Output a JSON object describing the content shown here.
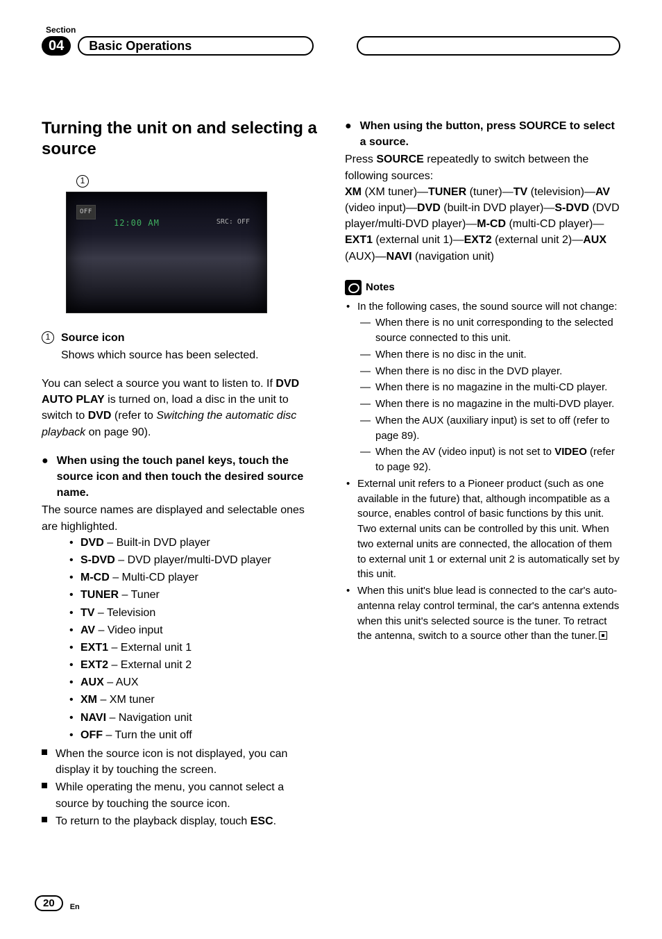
{
  "header": {
    "section_label": "Section",
    "section_number": "04",
    "chapter_title": "Basic Operations"
  },
  "left": {
    "main_heading": "Turning the unit on and selecting a source",
    "callout": "1",
    "screenshot": {
      "off_box": "OFF",
      "time": "12:00 AM",
      "src_off": "SRC: OFF"
    },
    "legend": {
      "num": "1",
      "title": "Source icon",
      "desc": "Shows which source has been selected."
    },
    "intro_1a": "You can select a source you want to listen to. If ",
    "intro_1b": "DVD AUTO PLAY",
    "intro_1c": " is turned on, load a disc in the unit to switch to ",
    "intro_1d": "DVD",
    "intro_1e": " (refer to ",
    "intro_1f": "Switching the automatic disc playback",
    "intro_1g": " on page 90).",
    "touch_head": "When using the touch panel keys, touch the source icon and then touch the desired source name.",
    "touch_body": "The source names are displayed and selectable ones are highlighted.",
    "sources": [
      {
        "key": "DVD",
        "desc": " – Built-in DVD player"
      },
      {
        "key": "S-DVD",
        "desc": " – DVD player/multi-DVD player"
      },
      {
        "key": "M-CD",
        "desc": " – Multi-CD player"
      },
      {
        "key": "TUNER",
        "desc": " – Tuner"
      },
      {
        "key": "TV",
        "desc": " – Television"
      },
      {
        "key": "AV",
        "desc": " – Video input"
      },
      {
        "key": "EXT1",
        "desc": " – External unit 1"
      },
      {
        "key": "EXT2",
        "desc": " – External unit 2"
      },
      {
        "key": "AUX",
        "desc": " – AUX"
      },
      {
        "key": "XM",
        "desc": " – XM tuner"
      },
      {
        "key": "NAVI",
        "desc": " – Navigation unit"
      },
      {
        "key": "OFF",
        "desc": " – Turn the unit off"
      }
    ],
    "note1": "When the source icon is not displayed, you can display it by touching the screen.",
    "note2": "While operating the menu, you cannot select a source by touching the source icon.",
    "note3a": "To return to the playback display, touch ",
    "note3b": "ESC",
    "note3c": "."
  },
  "right": {
    "button_head_a": "When using the button, press SOURCE to select a source.",
    "button_body_a": "Press ",
    "button_body_b": "SOURCE",
    "button_body_c": " repeatedly to switch between the following sources:",
    "chain": {
      "xm": "XM",
      "xm_d": " (XM tuner)—",
      "tuner": "TUNER",
      "tuner_d": " (tuner)—",
      "tv": "TV",
      "tv_d": " (television)—",
      "av": "AV",
      "av_d": " (video input)—",
      "dvd": "DVD",
      "dvd_d": " (built-in DVD player)—",
      "sdvd": "S-DVD",
      "sdvd_d": " (DVD player/multi-DVD player)—",
      "mcd": "M-CD",
      "mcd_d": " (multi-CD player)—",
      "ext1": "EXT1",
      "ext1_d": " (external unit 1)—",
      "ext2": "EXT2",
      "ext2_d": " (external unit 2)—",
      "aux": "AUX",
      "aux_d": " (AUX)—",
      "navi": "NAVI",
      "navi_d": " (navigation unit)"
    },
    "notes_label": "Notes",
    "n1_lead": "In the following cases, the sound source will not change:",
    "n1_items": [
      "When there is no unit corresponding to the selected source connected to this unit.",
      "When there is no disc in the unit.",
      "When there is no disc in the DVD player.",
      "When there is no magazine in the multi-CD player.",
      "When there is no magazine in the multi-DVD player.",
      "When the AUX (auxiliary input) is set to off (refer to page 89)."
    ],
    "n1_last_a": "When the AV (video input) is not set to ",
    "n1_last_b": "VIDEO",
    "n1_last_c": " (refer to page 92).",
    "n2": "External unit refers to a Pioneer product (such as one available in the future) that, although incompatible as a source, enables control of basic functions by this unit. Two external units can be controlled by this unit. When two external units are connected, the allocation of them to external unit 1 or external unit 2 is automatically set by this unit.",
    "n3": "When this unit's blue lead is connected to the car's auto-antenna relay control terminal, the car's antenna extends when this unit's selected source is the tuner. To retract the antenna, switch to a source other than the tuner."
  },
  "footer": {
    "page": "20",
    "lang": "En"
  }
}
